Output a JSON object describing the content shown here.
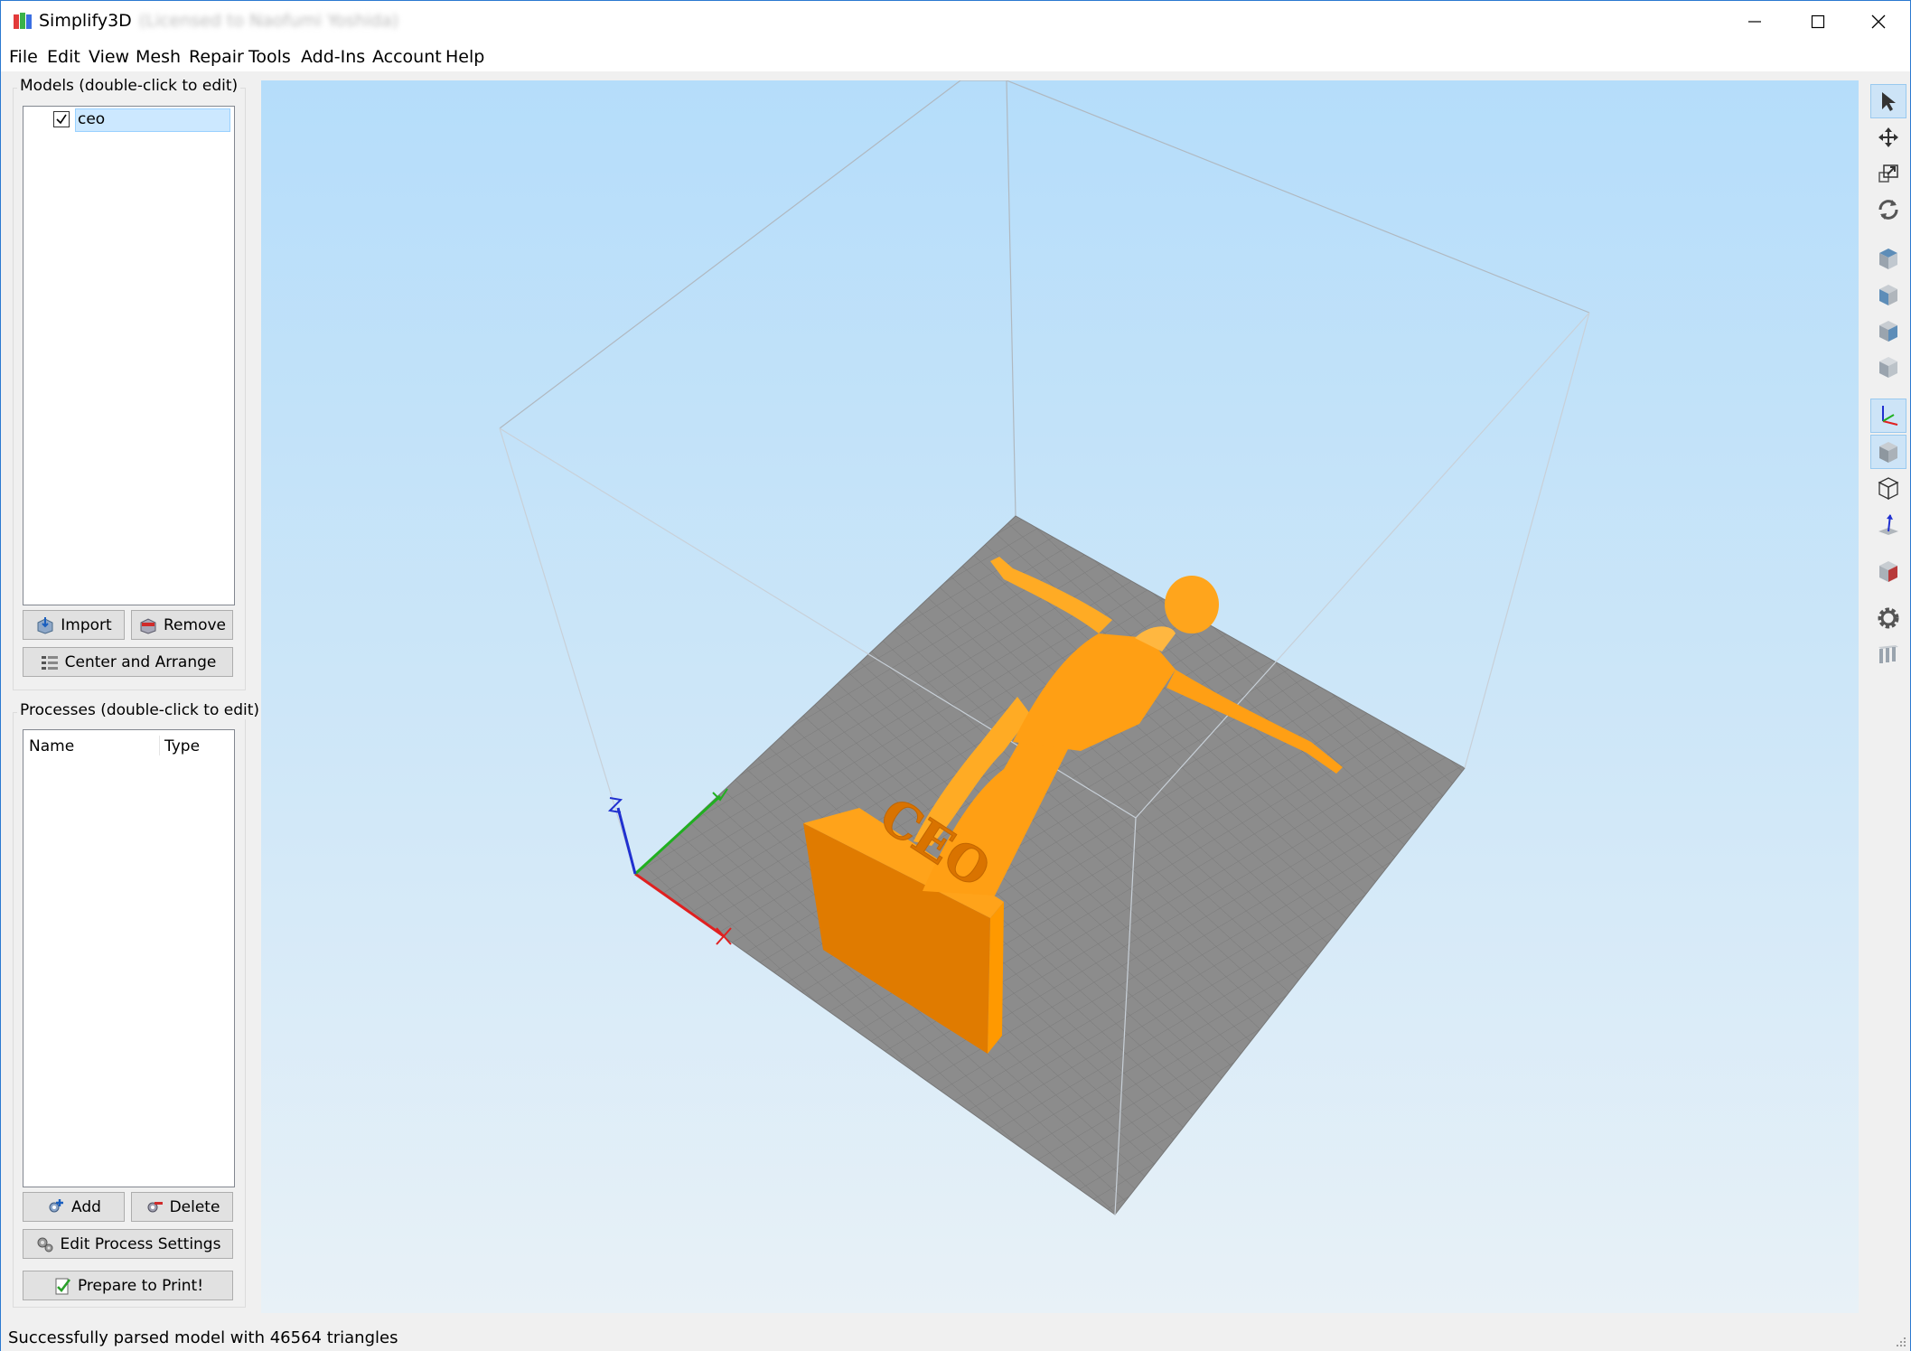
{
  "window": {
    "app_name": "Simplify3D",
    "license_text": "(Licensed to Naofumi Yoshida)",
    "minimize_icon": "minimize-icon",
    "maximize_icon": "maximize-icon",
    "close_icon": "close-icon"
  },
  "menu": [
    "File",
    "Edit",
    "View",
    "Mesh",
    "Repair",
    "Tools",
    "Add-Ins",
    "Account",
    "Help"
  ],
  "models_panel": {
    "title": "Models (double-click to edit)",
    "items": [
      {
        "name": "ceo",
        "checked": true,
        "selected": true
      }
    ],
    "import_label": "Import",
    "remove_label": "Remove",
    "center_arrange_label": "Center and Arrange"
  },
  "processes_panel": {
    "title": "Processes (double-click to edit)",
    "columns": [
      "Name",
      "Type"
    ],
    "add_label": "Add",
    "delete_label": "Delete",
    "edit_settings_label": "Edit Process Settings",
    "prepare_label": "Prepare to Print!"
  },
  "viewport": {
    "model_text": "CEO",
    "model_color": "#ff9900",
    "bed_color": "#8c8c8c",
    "axis_colors": {
      "x": "#e02020",
      "y": "#20b020",
      "z": "#2030d0"
    }
  },
  "right_toolbar": [
    {
      "icon": "select-cursor-icon",
      "active": true
    },
    {
      "icon": "move-icon",
      "active": false
    },
    {
      "icon": "scale-icon",
      "active": false
    },
    {
      "icon": "rotate-icon",
      "active": false
    },
    {
      "icon": "view-top-icon",
      "active": false
    },
    {
      "icon": "view-front-icon",
      "active": false
    },
    {
      "icon": "view-side-icon",
      "active": false
    },
    {
      "icon": "view-iso-icon",
      "active": false
    },
    {
      "icon": "axes-toggle-icon",
      "active": true
    },
    {
      "icon": "solid-view-icon",
      "active": true
    },
    {
      "icon": "wireframe-view-icon",
      "active": false
    },
    {
      "icon": "normals-icon",
      "active": false
    },
    {
      "icon": "cross-section-icon",
      "active": false
    },
    {
      "icon": "settings-gear-icon",
      "active": false
    },
    {
      "icon": "supports-icon",
      "active": false
    }
  ],
  "status": {
    "text": "Successfully parsed model with 46564 triangles"
  }
}
